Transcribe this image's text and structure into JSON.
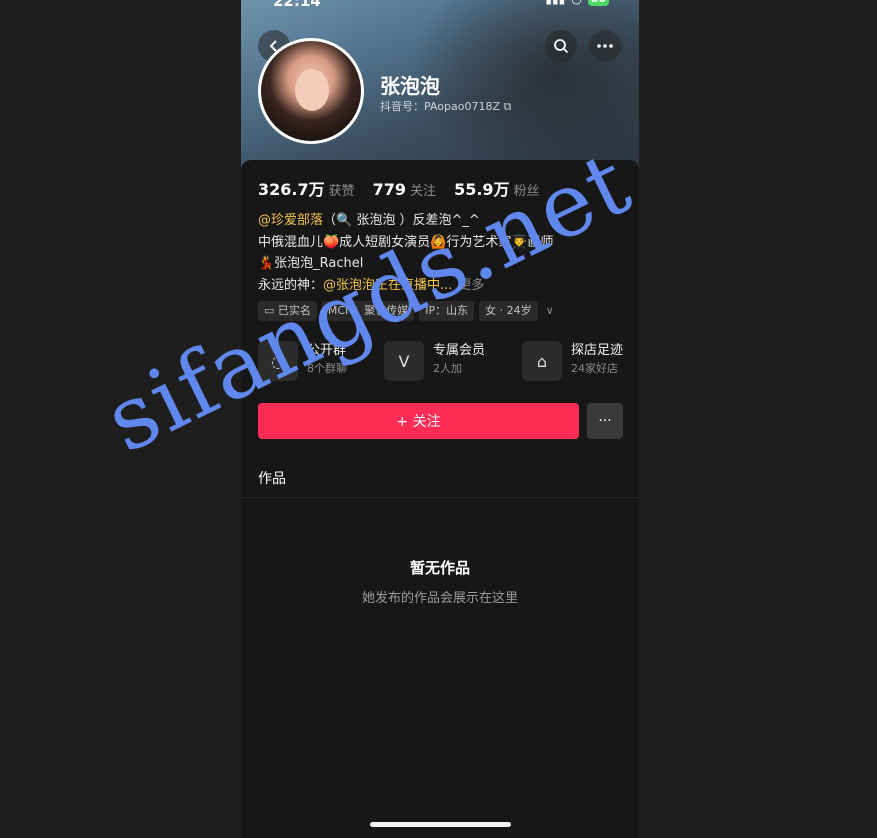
{
  "status": {
    "time": "22:14",
    "battery": "80"
  },
  "profile": {
    "name": "张泡泡",
    "douyin_id": "抖音号：PAopao0718Z"
  },
  "stats": [
    {
      "num": "326.7万",
      "label": "获赞"
    },
    {
      "num": "779",
      "label": "关注"
    },
    {
      "num": "55.9万",
      "label": "粉丝"
    }
  ],
  "bio": {
    "line1_link": "@珍爱部落",
    "line1_rest": "（🔍 张泡泡 ）反差泡^_^",
    "line2": "中俄混血儿🍑成人短剧女演员🙆行为艺术家👨‍🎓画师",
    "line3": "💃张泡泡_Rachel",
    "line4_prefix": "永远的神：",
    "line4_link": "@张泡泡正在直播中...",
    "line4_more": "更多"
  },
  "tags": [
    "已实名",
    "MCN：聚艺传媒",
    "IP：山东",
    "女 · 24岁"
  ],
  "features": [
    {
      "title": "公开群",
      "sub": "8个群聊"
    },
    {
      "title": "专属会员",
      "sub": "2人加"
    },
    {
      "title": "探店足迹",
      "sub": "24家好店"
    }
  ],
  "actions": {
    "follow": "+ 关注"
  },
  "tabs": {
    "works": "作品"
  },
  "empty": {
    "title": "暂无作品",
    "sub": "她发布的作品会展示在这里"
  },
  "watermark": "sifangds.net",
  "colors": {
    "accent": "#fe2c55",
    "link": "#f3c34b",
    "watermark": "#5f87ec"
  }
}
